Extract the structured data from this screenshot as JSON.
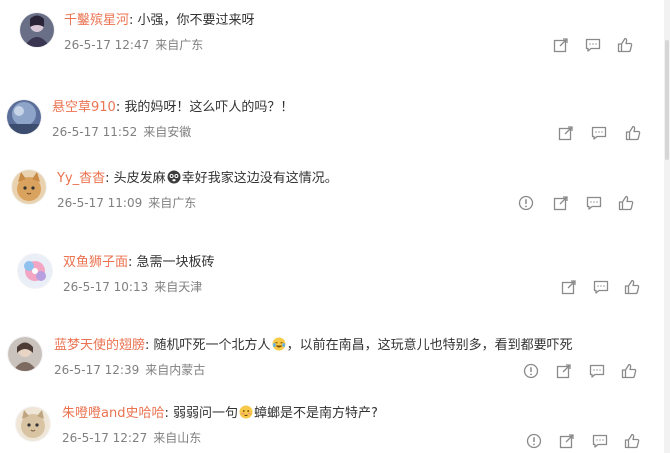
{
  "comments": [
    {
      "username": "千鑿殡星河",
      "sep": ":",
      "text": "小强，你不要过来呀",
      "date": "26-5-17 12:47",
      "location": "来自广东",
      "actions": [
        "share-icon",
        "comment-icon",
        "like-icon"
      ]
    },
    {
      "username": "悬空草910",
      "sep": ":",
      "text": "我的妈呀！这么吓人的吗？！",
      "date": "26-5-17 11:52",
      "location": "来自安徽",
      "actions": [
        "share-icon",
        "comment-icon",
        "like-icon"
      ]
    },
    {
      "username": "Yy_杳杳",
      "sep": ":",
      "text_before": "头皮发麻",
      "emoji_name": "scared-emoji",
      "text_after": "幸好我家这边没有这情况。",
      "date": "26-5-17 11:09",
      "location": "来自广东",
      "actions": [
        "report-icon",
        "share-icon",
        "comment-icon",
        "like-icon"
      ]
    },
    {
      "username": "双鱼狮子面",
      "sep": ":",
      "text": "急需一块板砖",
      "date": "26-5-17 10:13",
      "location": "来自天津",
      "actions": [
        "share-icon",
        "comment-icon",
        "like-icon"
      ]
    },
    {
      "username": "蓝梦天使的翅膀",
      "sep": ":",
      "text_before": "随机吓死一个北方人",
      "emoji_name": "laugh-cry-emoji",
      "text_after": "，以前在南昌，这玩意儿也特别多，看到都要吓死",
      "date": "26-5-17 12:39",
      "location": "来自内蒙古",
      "actions": [
        "report-icon",
        "share-icon",
        "comment-icon",
        "like-icon"
      ]
    },
    {
      "username": "朱噔噔and史哈哈",
      "sep": ":",
      "text_before": "弱弱问一句",
      "emoji_name": "shy-emoji",
      "text_after": "蟑螂是不是南方特产?",
      "date": "26-5-17 12:27",
      "location": "来自山东",
      "actions": [
        "report-icon",
        "share-icon",
        "comment-icon",
        "like-icon"
      ]
    }
  ],
  "colors": {
    "username": "#eb7350",
    "text": "#333333",
    "meta": "#808080",
    "icon": "#8a8a8a"
  }
}
